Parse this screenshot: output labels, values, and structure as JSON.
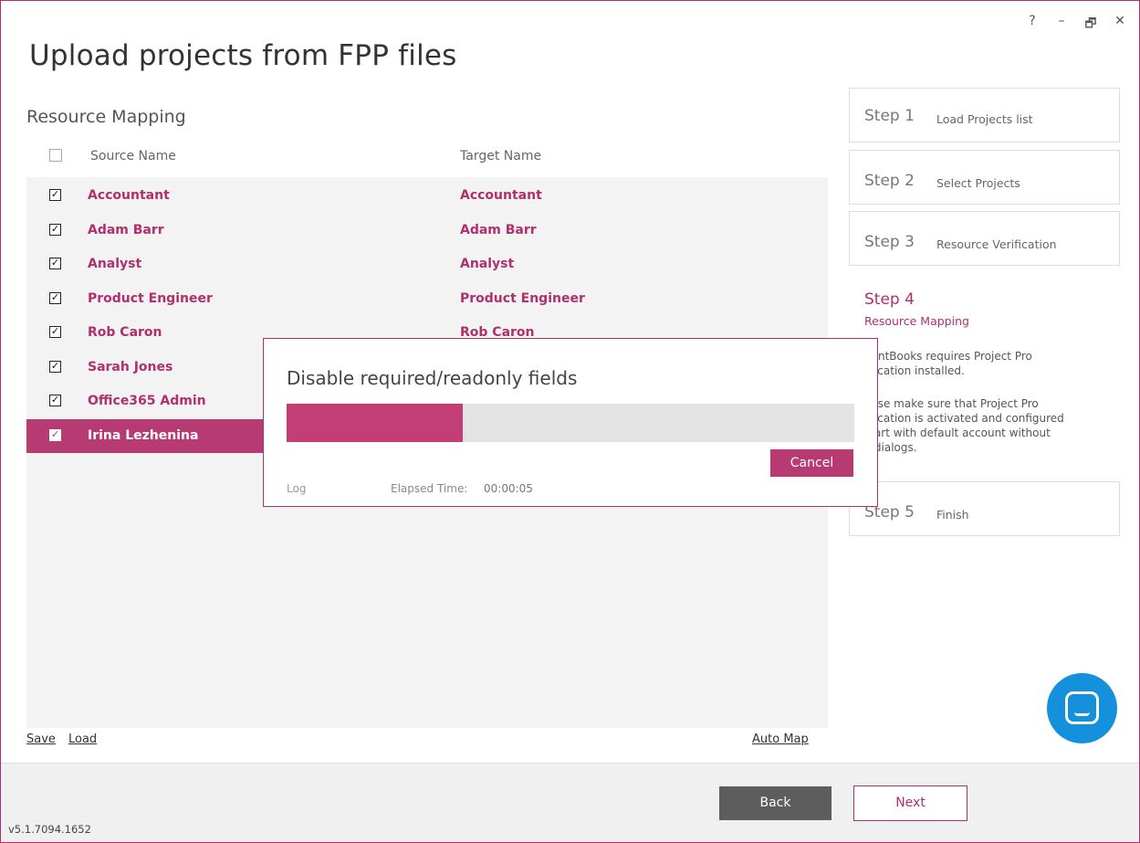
{
  "window": {
    "title": "Upload projects from FPP files",
    "controls": {
      "help": "?",
      "minimize": "–",
      "restore": "🗗",
      "close": "✕"
    }
  },
  "section_title": "Resource Mapping",
  "grid": {
    "headers": {
      "source": "Source Name",
      "target": "Target Name"
    },
    "rows": [
      {
        "checked": true,
        "source": "Accountant",
        "target": "Accountant",
        "selected": false
      },
      {
        "checked": true,
        "source": "Adam Barr",
        "target": "Adam Barr",
        "selected": false
      },
      {
        "checked": true,
        "source": "Analyst",
        "target": "Analyst",
        "selected": false
      },
      {
        "checked": true,
        "source": "Product Engineer",
        "target": "Product Engineer",
        "selected": false
      },
      {
        "checked": true,
        "source": "Rob Caron",
        "target": "Rob Caron",
        "selected": false
      },
      {
        "checked": true,
        "source": "Sarah Jones",
        "target": "",
        "selected": false
      },
      {
        "checked": true,
        "source": "Office365 Admin",
        "target": "",
        "selected": false
      },
      {
        "checked": true,
        "source": "Irina Lezhenina",
        "target": "",
        "selected": true
      }
    ],
    "check_mark": "✓"
  },
  "footer_links": {
    "save": "Save",
    "load": "Load",
    "auto_map": "Auto Map"
  },
  "steps": [
    {
      "num": "Step 1",
      "label": "Load Projects list"
    },
    {
      "num": "Step 2",
      "label": "Select Projects"
    },
    {
      "num": "Step 3",
      "label": "Resource Verification"
    },
    {
      "num": "Step 4",
      "label": "Resource Mapping",
      "desc1": "uentBooks requires Project Pro\nplication installed.",
      "desc2": "ease make sure that Project Pro\nplication is activated and configured\nstart with default account without\ny dialogs."
    },
    {
      "num": "Step 5",
      "label": "Finish"
    }
  ],
  "buttons": {
    "back": "Back",
    "next": "Next"
  },
  "version": "v5.1.7094.1652",
  "modal": {
    "title": "Disable required/readonly fields",
    "progress": 0.31,
    "cancel": "Cancel",
    "log": "Log",
    "elapsed_label": "Elapsed Time:",
    "elapsed_value": "00:00:05"
  },
  "colors": {
    "accent": "#b0306e",
    "chat": "#1490dd"
  },
  "icons": {
    "chat": "chat-bubble-icon"
  }
}
